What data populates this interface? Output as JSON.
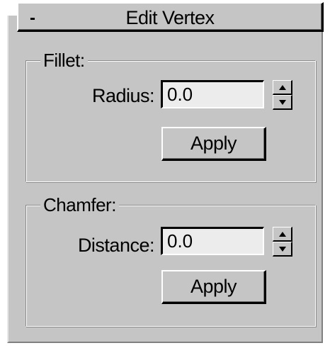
{
  "rollout": {
    "collapse_sign": "-",
    "title": "Edit Vertex"
  },
  "fillet": {
    "group_label": "Fillet:",
    "field_label": "Radius:",
    "value": "0.0",
    "apply_label": "Apply"
  },
  "chamfer": {
    "group_label": "Chamfer:",
    "field_label": "Distance:",
    "value": "0.0",
    "apply_label": "Apply"
  },
  "colors": {
    "panel_bg": "#c5c5c5",
    "input_bg": "#ececec"
  }
}
